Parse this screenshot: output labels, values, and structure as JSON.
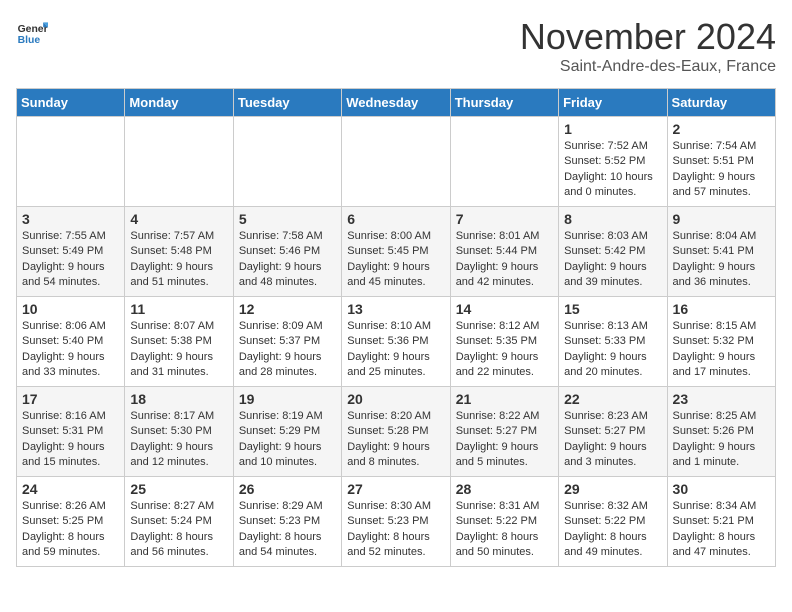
{
  "header": {
    "logo_line1": "General",
    "logo_line2": "Blue",
    "month": "November 2024",
    "location": "Saint-Andre-des-Eaux, France"
  },
  "weekdays": [
    "Sunday",
    "Monday",
    "Tuesday",
    "Wednesday",
    "Thursday",
    "Friday",
    "Saturday"
  ],
  "weeks": [
    [
      {
        "day": "",
        "info": ""
      },
      {
        "day": "",
        "info": ""
      },
      {
        "day": "",
        "info": ""
      },
      {
        "day": "",
        "info": ""
      },
      {
        "day": "",
        "info": ""
      },
      {
        "day": "1",
        "info": "Sunrise: 7:52 AM\nSunset: 5:52 PM\nDaylight: 10 hours and 0 minutes."
      },
      {
        "day": "2",
        "info": "Sunrise: 7:54 AM\nSunset: 5:51 PM\nDaylight: 9 hours and 57 minutes."
      }
    ],
    [
      {
        "day": "3",
        "info": "Sunrise: 7:55 AM\nSunset: 5:49 PM\nDaylight: 9 hours and 54 minutes."
      },
      {
        "day": "4",
        "info": "Sunrise: 7:57 AM\nSunset: 5:48 PM\nDaylight: 9 hours and 51 minutes."
      },
      {
        "day": "5",
        "info": "Sunrise: 7:58 AM\nSunset: 5:46 PM\nDaylight: 9 hours and 48 minutes."
      },
      {
        "day": "6",
        "info": "Sunrise: 8:00 AM\nSunset: 5:45 PM\nDaylight: 9 hours and 45 minutes."
      },
      {
        "day": "7",
        "info": "Sunrise: 8:01 AM\nSunset: 5:44 PM\nDaylight: 9 hours and 42 minutes."
      },
      {
        "day": "8",
        "info": "Sunrise: 8:03 AM\nSunset: 5:42 PM\nDaylight: 9 hours and 39 minutes."
      },
      {
        "day": "9",
        "info": "Sunrise: 8:04 AM\nSunset: 5:41 PM\nDaylight: 9 hours and 36 minutes."
      }
    ],
    [
      {
        "day": "10",
        "info": "Sunrise: 8:06 AM\nSunset: 5:40 PM\nDaylight: 9 hours and 33 minutes."
      },
      {
        "day": "11",
        "info": "Sunrise: 8:07 AM\nSunset: 5:38 PM\nDaylight: 9 hours and 31 minutes."
      },
      {
        "day": "12",
        "info": "Sunrise: 8:09 AM\nSunset: 5:37 PM\nDaylight: 9 hours and 28 minutes."
      },
      {
        "day": "13",
        "info": "Sunrise: 8:10 AM\nSunset: 5:36 PM\nDaylight: 9 hours and 25 minutes."
      },
      {
        "day": "14",
        "info": "Sunrise: 8:12 AM\nSunset: 5:35 PM\nDaylight: 9 hours and 22 minutes."
      },
      {
        "day": "15",
        "info": "Sunrise: 8:13 AM\nSunset: 5:33 PM\nDaylight: 9 hours and 20 minutes."
      },
      {
        "day": "16",
        "info": "Sunrise: 8:15 AM\nSunset: 5:32 PM\nDaylight: 9 hours and 17 minutes."
      }
    ],
    [
      {
        "day": "17",
        "info": "Sunrise: 8:16 AM\nSunset: 5:31 PM\nDaylight: 9 hours and 15 minutes."
      },
      {
        "day": "18",
        "info": "Sunrise: 8:17 AM\nSunset: 5:30 PM\nDaylight: 9 hours and 12 minutes."
      },
      {
        "day": "19",
        "info": "Sunrise: 8:19 AM\nSunset: 5:29 PM\nDaylight: 9 hours and 10 minutes."
      },
      {
        "day": "20",
        "info": "Sunrise: 8:20 AM\nSunset: 5:28 PM\nDaylight: 9 hours and 8 minutes."
      },
      {
        "day": "21",
        "info": "Sunrise: 8:22 AM\nSunset: 5:27 PM\nDaylight: 9 hours and 5 minutes."
      },
      {
        "day": "22",
        "info": "Sunrise: 8:23 AM\nSunset: 5:27 PM\nDaylight: 9 hours and 3 minutes."
      },
      {
        "day": "23",
        "info": "Sunrise: 8:25 AM\nSunset: 5:26 PM\nDaylight: 9 hours and 1 minute."
      }
    ],
    [
      {
        "day": "24",
        "info": "Sunrise: 8:26 AM\nSunset: 5:25 PM\nDaylight: 8 hours and 59 minutes."
      },
      {
        "day": "25",
        "info": "Sunrise: 8:27 AM\nSunset: 5:24 PM\nDaylight: 8 hours and 56 minutes."
      },
      {
        "day": "26",
        "info": "Sunrise: 8:29 AM\nSunset: 5:23 PM\nDaylight: 8 hours and 54 minutes."
      },
      {
        "day": "27",
        "info": "Sunrise: 8:30 AM\nSunset: 5:23 PM\nDaylight: 8 hours and 52 minutes."
      },
      {
        "day": "28",
        "info": "Sunrise: 8:31 AM\nSunset: 5:22 PM\nDaylight: 8 hours and 50 minutes."
      },
      {
        "day": "29",
        "info": "Sunrise: 8:32 AM\nSunset: 5:22 PM\nDaylight: 8 hours and 49 minutes."
      },
      {
        "day": "30",
        "info": "Sunrise: 8:34 AM\nSunset: 5:21 PM\nDaylight: 8 hours and 47 minutes."
      }
    ]
  ]
}
